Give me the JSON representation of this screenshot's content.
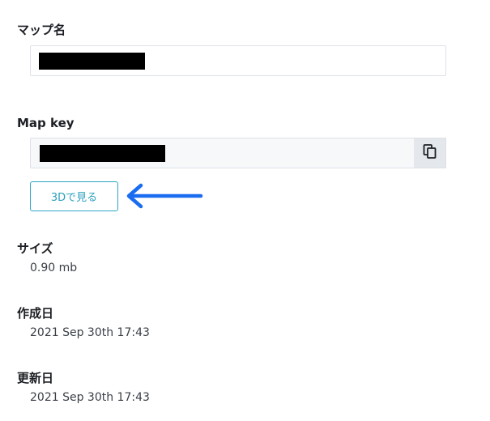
{
  "map_name": {
    "label": "マップ名",
    "value_redacted": true
  },
  "map_key": {
    "label": "Map key",
    "value_redacted": true,
    "copy_icon": "copy-icon"
  },
  "view3d": {
    "label": "3Dで見る",
    "annotation_icon": "arrow-left-icon",
    "annotation_color": "#1a6cf0"
  },
  "size": {
    "label": "サイズ",
    "value": "0.90 mb"
  },
  "created": {
    "label": "作成日",
    "value": "2021 Sep 30th 17:43"
  },
  "updated": {
    "label": "更新日",
    "value": "2021 Sep 30th 17:43"
  },
  "colors": {
    "accent": "#2da6c6",
    "field_border": "#dde2e8",
    "readonly_bg": "#f6f8fa"
  }
}
